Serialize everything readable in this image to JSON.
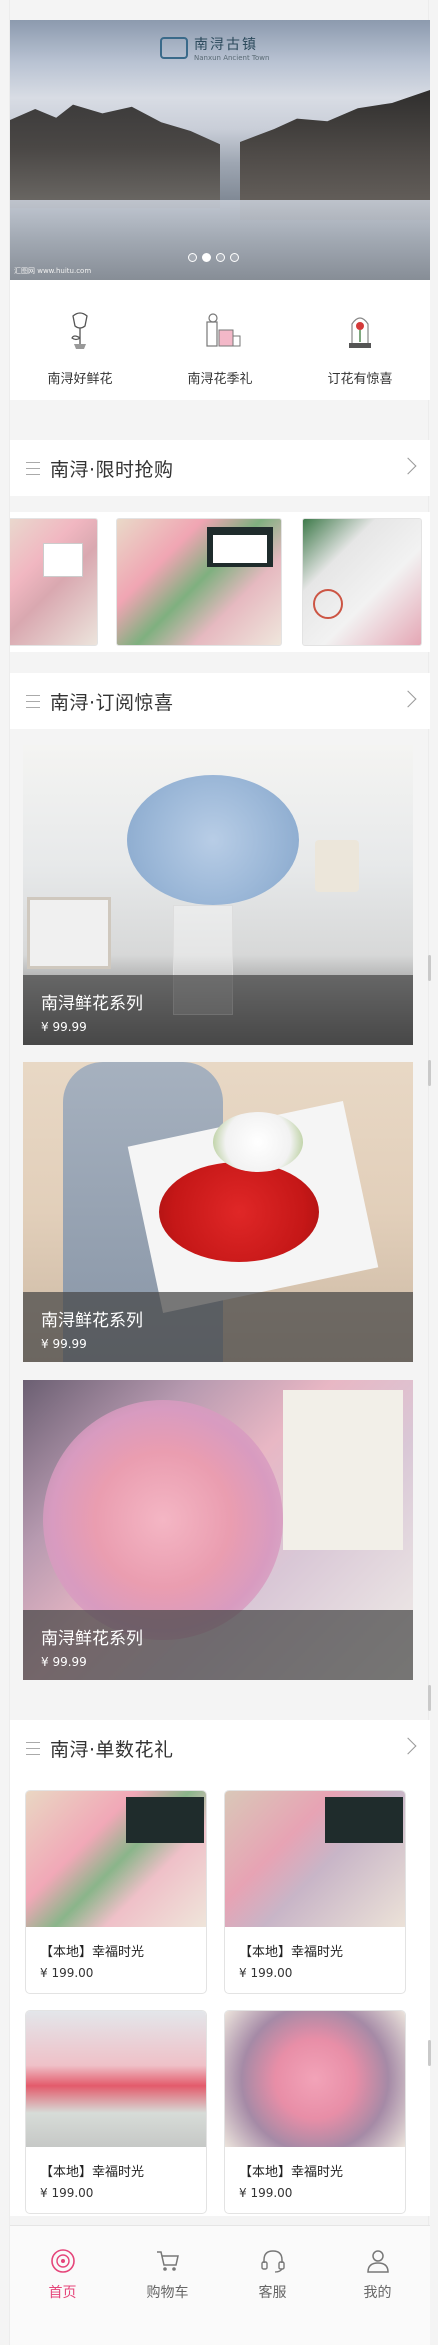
{
  "banner": {
    "logo_text": "南浔古镇",
    "logo_sub": "Nanxun Ancient Town",
    "copyright": "汇图网 www.huitu.com",
    "dot_count": 4,
    "active_dot": 1
  },
  "quick_nav": [
    {
      "label": "南浔好鲜花",
      "icon": "flower-icon"
    },
    {
      "label": "南浔花季礼",
      "icon": "gift-icon"
    },
    {
      "label": "订花有惊喜",
      "icon": "rose-dome-icon"
    }
  ],
  "sections": {
    "flash": {
      "title": "南浔·限时抢购"
    },
    "subscribe": {
      "title": "南浔·订阅惊喜"
    },
    "single": {
      "title": "南浔·单数花礼"
    }
  },
  "subscribe_items": [
    {
      "name": "南浔鲜花系列",
      "price": "¥ 99.99"
    },
    {
      "name": "南浔鲜花系列",
      "price": "¥ 99.99"
    },
    {
      "name": "南浔鲜花系列",
      "price": "¥ 99.99"
    }
  ],
  "products": [
    {
      "name": "【本地】幸福时光",
      "price": "¥ 199.00"
    },
    {
      "name": "【本地】幸福时光",
      "price": "¥ 199.00"
    },
    {
      "name": "【本地】幸福时光",
      "price": "¥ 199.00"
    },
    {
      "name": "【本地】幸福时光",
      "price": "¥ 199.00"
    }
  ],
  "tabbar": [
    {
      "label": "首页",
      "icon": "home-icon",
      "active": true
    },
    {
      "label": "购物车",
      "icon": "cart-icon",
      "active": false
    },
    {
      "label": "客服",
      "icon": "headset-icon",
      "active": false
    },
    {
      "label": "我的",
      "icon": "user-icon",
      "active": false
    }
  ],
  "colors": {
    "accent": "#e5457a",
    "overlay": "#464646"
  }
}
